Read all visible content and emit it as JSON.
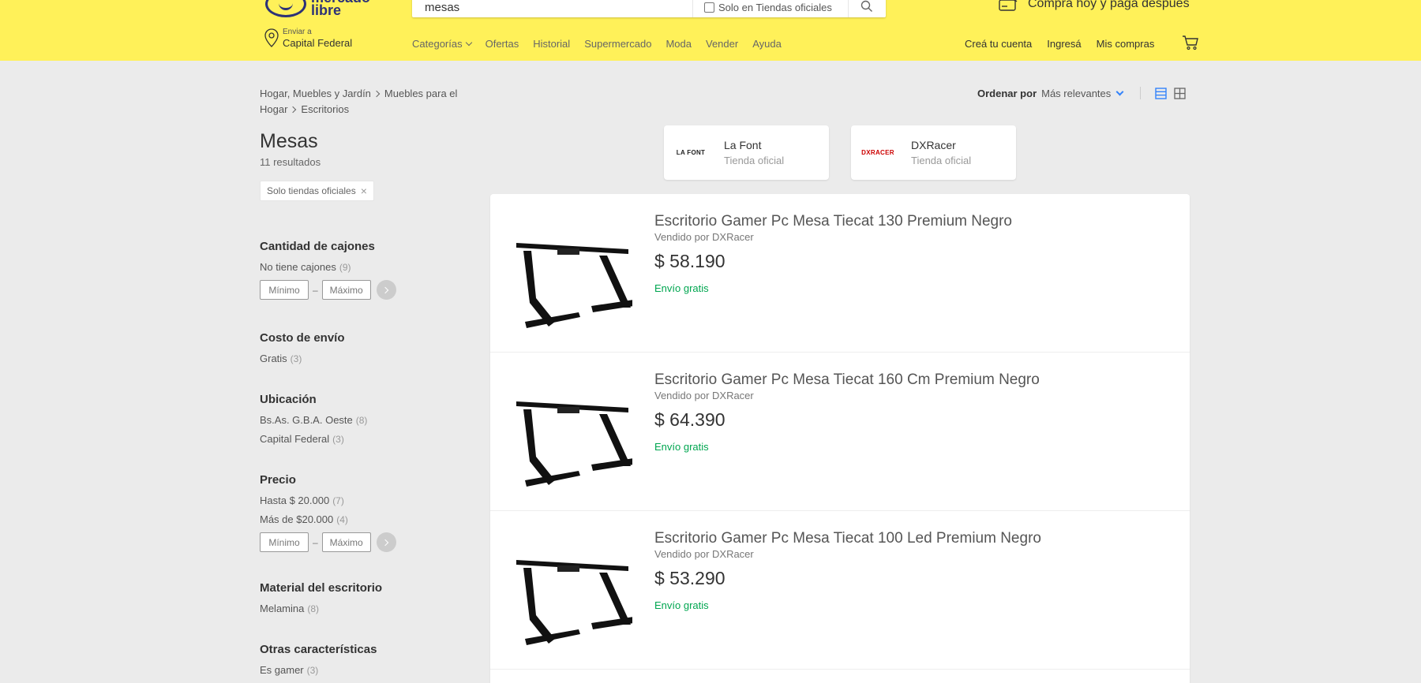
{
  "header": {
    "logo_text": "mercado libre",
    "search": {
      "value": "mesas",
      "official_label": "Solo en Tiendas oficiales"
    },
    "promo": "Comprá hoy y pagá después",
    "ship_to": {
      "label": "Enviar a",
      "location": "Capital Federal"
    },
    "nav": [
      "Categorías",
      "Ofertas",
      "Historial",
      "Supermercado",
      "Moda",
      "Vender",
      "Ayuda"
    ],
    "account": [
      "Creá tu cuenta",
      "Ingresá",
      "Mis compras"
    ]
  },
  "breadcrumb": {
    "items": [
      "Hogar, Muebles y Jardín",
      "Muebles para el",
      "Hogar",
      "Escritorios"
    ]
  },
  "sort": {
    "label": "Ordenar por",
    "value": "Más relevantes"
  },
  "page": {
    "title": "Mesas",
    "results": "11 resultados",
    "chip": "Solo tiendas oficiales"
  },
  "filters": [
    {
      "title": "Cantidad de cajones",
      "options": [
        {
          "label": "No tiene cajones",
          "count": "(9)"
        }
      ],
      "range": {
        "min": "Mínimo",
        "max": "Máximo"
      }
    },
    {
      "title": "Costo de envío",
      "options": [
        {
          "label": "Gratis",
          "count": "(3)"
        }
      ]
    },
    {
      "title": "Ubicación",
      "options": [
        {
          "label": "Bs.As. G.B.A. Oeste",
          "count": "(8)"
        },
        {
          "label": "Capital Federal",
          "count": "(3)"
        }
      ]
    },
    {
      "title": "Precio",
      "options": [
        {
          "label": "Hasta $ 20.000",
          "count": "(7)"
        },
        {
          "label": "Más de $20.000",
          "count": "(4)"
        }
      ],
      "range": {
        "min": "Mínimo",
        "max": "Máximo"
      }
    },
    {
      "title": "Material del escritorio",
      "options": [
        {
          "label": "Melamina",
          "count": "(8)"
        }
      ]
    },
    {
      "title": "Otras características",
      "options": [
        {
          "label": "Es gamer",
          "count": "(3)"
        }
      ]
    }
  ],
  "stores": [
    {
      "logo": "LA FONT",
      "name": "La Font",
      "sub": "Tienda oficial"
    },
    {
      "logo": "DXRACER",
      "name": "DXRacer",
      "sub": "Tienda oficial"
    }
  ],
  "products": [
    {
      "title": "Escritorio Gamer Pc Mesa Tiecat 130 Premium Negro",
      "seller": "Vendido por DXRacer",
      "price": "$ 58.190",
      "shipping": "Envío gratis"
    },
    {
      "title": "Escritorio Gamer Pc Mesa Tiecat 160 Cm Premium Negro",
      "seller": "Vendido por DXRacer",
      "price": "$ 64.390",
      "shipping": "Envío gratis"
    },
    {
      "title": "Escritorio Gamer Pc Mesa Tiecat 100 Led Premium Negro",
      "seller": "Vendido por DXRacer",
      "price": "$ 53.290",
      "shipping": "Envío gratis"
    }
  ],
  "colors": {
    "header_bg": "#fff159",
    "accent": "#3483fa",
    "free_shipping": "#00a650"
  }
}
